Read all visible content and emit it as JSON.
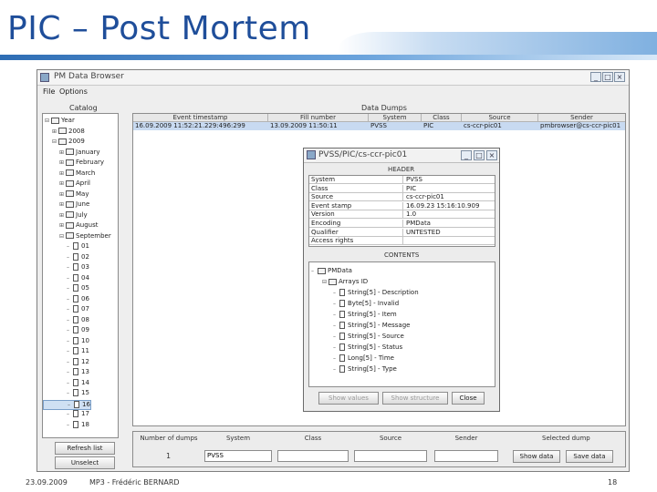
{
  "slide": {
    "title": "PIC – Post Mortem",
    "footer_date": "23.09.2009",
    "footer_author": "MP3 - Frédéric BERNARD",
    "page_number": "18"
  },
  "window": {
    "title": "PM Data Browser",
    "minimize_symbol": "_",
    "maximize_symbol": "□",
    "close_symbol": "×",
    "menu": [
      "File",
      "Options"
    ]
  },
  "catalog": {
    "label": "Catalog",
    "tree": [
      {
        "label": "Year",
        "level": 0,
        "type": "folder",
        "expander": "⊟"
      },
      {
        "label": "2008",
        "level": 1,
        "type": "folder",
        "expander": "⊞"
      },
      {
        "label": "2009",
        "level": 1,
        "type": "folder",
        "expander": "⊟"
      },
      {
        "label": "January",
        "level": 2,
        "type": "folder",
        "expander": "⊞"
      },
      {
        "label": "February",
        "level": 2,
        "type": "folder",
        "expander": "⊞"
      },
      {
        "label": "March",
        "level": 2,
        "type": "folder",
        "expander": "⊞"
      },
      {
        "label": "April",
        "level": 2,
        "type": "folder",
        "expander": "⊞"
      },
      {
        "label": "May",
        "level": 2,
        "type": "folder",
        "expander": "⊞"
      },
      {
        "label": "June",
        "level": 2,
        "type": "folder",
        "expander": "⊞"
      },
      {
        "label": "July",
        "level": 2,
        "type": "folder",
        "expander": "⊞"
      },
      {
        "label": "August",
        "level": 2,
        "type": "folder",
        "expander": "⊞"
      },
      {
        "label": "September",
        "level": 2,
        "type": "folder",
        "expander": "⊟"
      },
      {
        "label": "01",
        "level": 3,
        "type": "doc"
      },
      {
        "label": "02",
        "level": 3,
        "type": "doc"
      },
      {
        "label": "03",
        "level": 3,
        "type": "doc"
      },
      {
        "label": "04",
        "level": 3,
        "type": "doc"
      },
      {
        "label": "05",
        "level": 3,
        "type": "doc"
      },
      {
        "label": "06",
        "level": 3,
        "type": "doc"
      },
      {
        "label": "07",
        "level": 3,
        "type": "doc"
      },
      {
        "label": "08",
        "level": 3,
        "type": "doc"
      },
      {
        "label": "09",
        "level": 3,
        "type": "doc"
      },
      {
        "label": "10",
        "level": 3,
        "type": "doc"
      },
      {
        "label": "11",
        "level": 3,
        "type": "doc"
      },
      {
        "label": "12",
        "level": 3,
        "type": "doc"
      },
      {
        "label": "13",
        "level": 3,
        "type": "doc"
      },
      {
        "label": "14",
        "level": 3,
        "type": "doc"
      },
      {
        "label": "15",
        "level": 3,
        "type": "doc"
      },
      {
        "label": "16",
        "level": 3,
        "type": "doc",
        "selected": true
      },
      {
        "label": "17",
        "level": 3,
        "type": "doc"
      },
      {
        "label": "18",
        "level": 3,
        "type": "doc"
      }
    ],
    "refresh_button": "Refresh list",
    "unselect_button": "Unselect"
  },
  "data_dumps": {
    "label": "Data Dumps",
    "columns": [
      "Event timestamp",
      "Fill number",
      "System",
      "Class",
      "Source",
      "Sender"
    ],
    "rows": [
      [
        "16.09.2009 11:52:21.229:496:299",
        "13.09.2009 11:50:11",
        "PVSS",
        "PIC",
        "cs-ccr-pic01",
        "pmbrowser@cs-ccr-pic01"
      ]
    ]
  },
  "dump_dialog": {
    "title": "PVSS/PIC/cs-ccr-pic01",
    "header_label": "HEADER",
    "header": [
      {
        "key": "System",
        "value": "PVSS"
      },
      {
        "key": "Class",
        "value": "PIC"
      },
      {
        "key": "Source",
        "value": "cs-ccr-pic01"
      },
      {
        "key": "Event stamp",
        "value": "16.09.23 15:16:10.909"
      },
      {
        "key": "Version",
        "value": "1.0"
      },
      {
        "key": "Encoding",
        "value": "PMData"
      },
      {
        "key": "Qualifier",
        "value": "UNTESTED"
      },
      {
        "key": "Access rights",
        "value": ""
      }
    ],
    "contents_label": "CONTENTS",
    "contents": [
      {
        "label": "PMData",
        "level": 0,
        "type": "folder"
      },
      {
        "label": "Arrays ID",
        "level": 1,
        "type": "folder"
      },
      {
        "label": "String[5] - Description",
        "level": 2,
        "type": "doc"
      },
      {
        "label": "Byte[5] - Invalid",
        "level": 2,
        "type": "doc"
      },
      {
        "label": "String[5] - Item",
        "level": 2,
        "type": "doc"
      },
      {
        "label": "String[5] - Message",
        "level": 2,
        "type": "doc"
      },
      {
        "label": "String[5] - Source",
        "level": 2,
        "type": "doc"
      },
      {
        "label": "String[5] - Status",
        "level": 2,
        "type": "doc"
      },
      {
        "label": "Long[5] - Time",
        "level": 2,
        "type": "doc"
      },
      {
        "label": "String[5] - Type",
        "level": 2,
        "type": "doc"
      }
    ],
    "show_values": "Show values",
    "show_structure": "Show structure",
    "close": "Close"
  },
  "filters": {
    "fields": [
      {
        "label": "Number of dumps",
        "value": "1"
      },
      {
        "label": "System",
        "value": "PVSS"
      },
      {
        "label": "Class",
        "value": ""
      },
      {
        "label": "Source",
        "value": ""
      },
      {
        "label": "Sender",
        "value": ""
      }
    ],
    "selected_dump_label": "Selected dump",
    "show_data": "Show data",
    "save_data": "Save data"
  }
}
